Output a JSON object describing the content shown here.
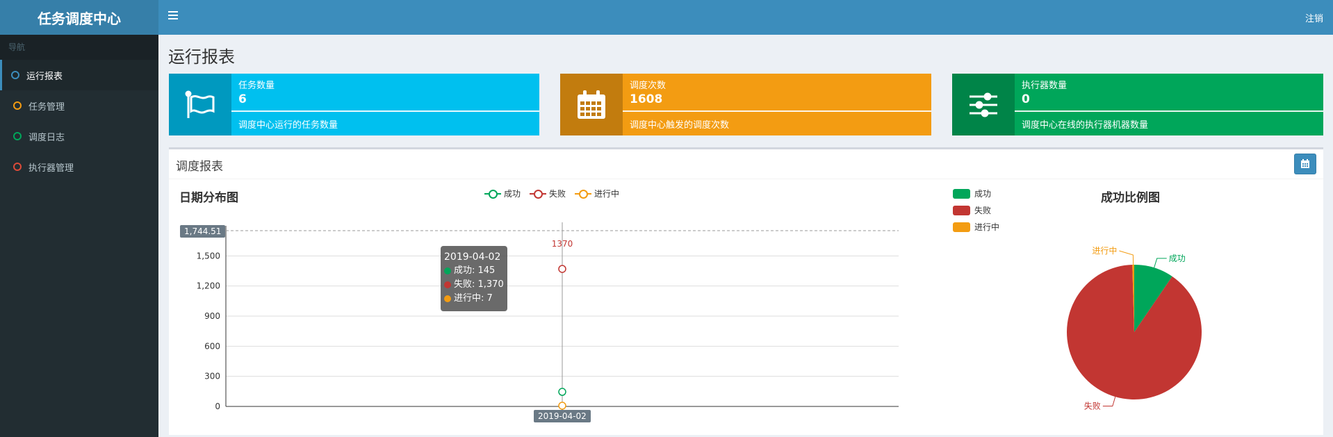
{
  "app": {
    "title": "任务调度中心",
    "logout": "注销"
  },
  "sidebar": {
    "header": "导航",
    "items": [
      {
        "label": "运行报表",
        "color": "#3c8dbc"
      },
      {
        "label": "任务管理",
        "color": "#f39c12"
      },
      {
        "label": "调度日志",
        "color": "#00a65a"
      },
      {
        "label": "执行器管理",
        "color": "#dd4b39"
      }
    ]
  },
  "page": {
    "title": "运行报表"
  },
  "info_boxes": [
    {
      "label": "任务数量",
      "value": "6",
      "desc": "调度中心运行的任务数量",
      "icon": "flag-icon",
      "color": "#00c0ef"
    },
    {
      "label": "调度次数",
      "value": "1608",
      "desc": "调度中心触发的调度次数",
      "icon": "calendar-icon",
      "color": "#f39c12"
    },
    {
      "label": "执行器数量",
      "value": "0",
      "desc": "调度中心在线的执行器机器数量",
      "icon": "sliders-icon",
      "color": "#00a65a"
    }
  ],
  "report": {
    "title": "调度报表",
    "line_title": "日期分布图",
    "pie_title": "成功比例图",
    "tooltip": {
      "date": "2019-04-02",
      "rows": [
        "成功: 145",
        "失败: 1,370",
        "进行中: 7"
      ]
    },
    "axis_pointer_y": "1,744.51",
    "axis_pointer_x": "2019-04-02",
    "point_label": "1370"
  },
  "chart_data": [
    {
      "type": "line",
      "title": "日期分布图",
      "x": [
        "2019-04-02"
      ],
      "ylim": [
        0,
        1800
      ],
      "yticks": [
        0,
        300,
        600,
        900,
        1200,
        1500
      ],
      "ytick_labels": [
        "0",
        "300",
        "600",
        "900",
        "1,200",
        "1,500"
      ],
      "series": [
        {
          "name": "成功",
          "values": [
            145
          ],
          "color": "#00a65a"
        },
        {
          "name": "失败",
          "values": [
            1370
          ],
          "color": "#c23632"
        },
        {
          "name": "进行中",
          "values": [
            7
          ],
          "color": "#f39c12"
        }
      ],
      "legend": "top-center"
    },
    {
      "type": "pie",
      "title": "成功比例图",
      "slices": [
        {
          "name": "成功",
          "value": 145,
          "color": "#00a65a"
        },
        {
          "name": "失败",
          "value": 1370,
          "color": "#c23632"
        },
        {
          "name": "进行中",
          "value": 7,
          "color": "#f39c12"
        }
      ],
      "legend": "top-left"
    }
  ]
}
